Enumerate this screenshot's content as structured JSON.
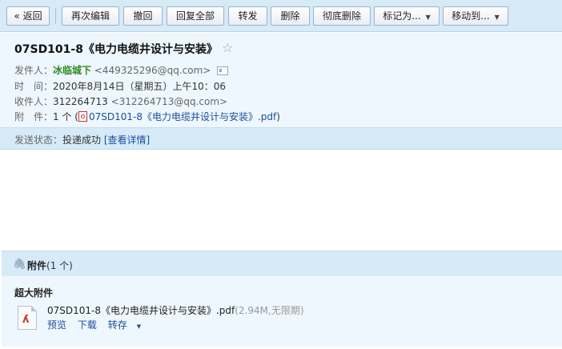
{
  "toolbar": {
    "back": "« 返回",
    "reedit": "再次编辑",
    "recall": "撤回",
    "reply_all": "回复全部",
    "forward": "转发",
    "delete": "删除",
    "delete_permanent": "彻底删除",
    "mark_as": "标记为...",
    "move_to": "移动到..."
  },
  "mail": {
    "subject": "07SD101-8《电力电缆井设计与安装》",
    "from_label": "发件人：",
    "from_name": "冰临城下",
    "from_addr": "<449325296@qq.com>",
    "time_label": "时　间：",
    "time_value": "2020年8月14日（星期五）上午10：06",
    "to_label": "收件人：",
    "to_name": "312264713",
    "to_addr": "<312264713@qq.com>",
    "att_label": "附　件：",
    "att_count": "1 个 (",
    "att_file": "07SD101-8《电力电缆井设计与安装》.pdf",
    "att_close": ")"
  },
  "status": {
    "label": "发送状态：",
    "value": "投递成功",
    "detail": "[查看详情]"
  },
  "attachments": {
    "title": "附件",
    "count": "(1 个)",
    "section_label": "超大附件",
    "file_name": "07SD101-8《电力电缆井设计与安装》.pdf",
    "file_meta": "(2.94M,无限期)",
    "preview": "预览",
    "download": "下载",
    "save_to": "转存"
  },
  "colors": {
    "toolbar_bg": "#d6eaf7",
    "header_bg": "#eef7fd",
    "link": "#1a4f9a",
    "sender": "#2d8a1e"
  }
}
